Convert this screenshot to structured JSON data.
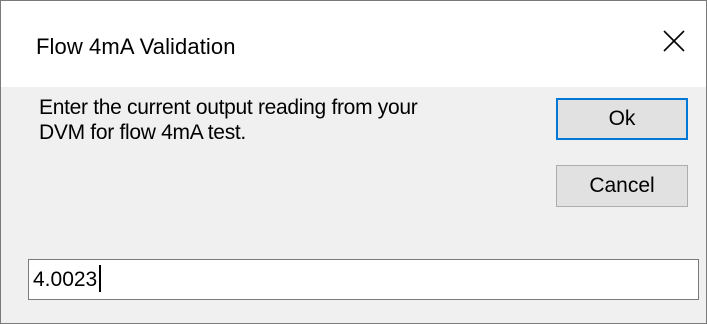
{
  "window": {
    "title": "Flow 4mA Validation",
    "close_icon": "close-icon"
  },
  "dialog": {
    "prompt_line1": "Enter the current output reading from your",
    "prompt_line2": "DVM for flow 4mA test.",
    "ok_label": "Ok",
    "cancel_label": "Cancel",
    "input_value": "4.0023"
  },
  "colors": {
    "accent": "#0078d7",
    "button_face": "#e1e1e1",
    "dialog_bg": "#f0f0f0"
  }
}
